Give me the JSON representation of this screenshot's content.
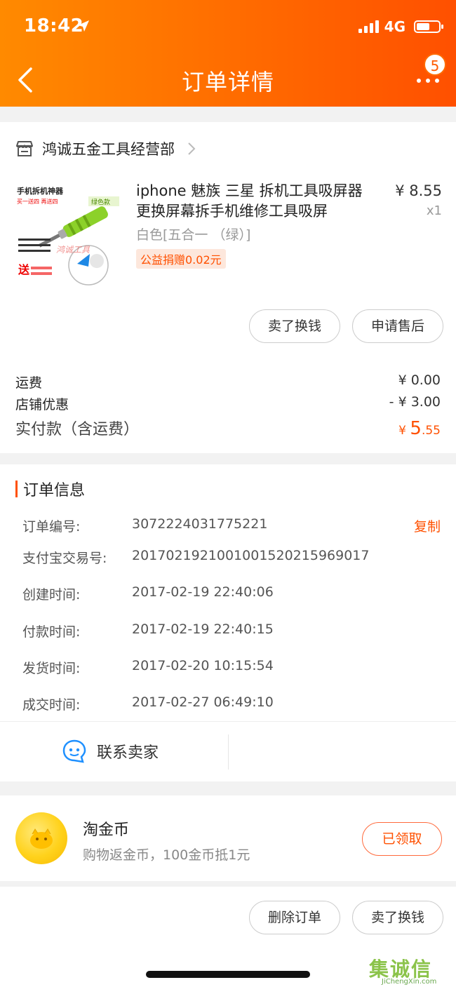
{
  "status_bar": {
    "time": "18:42",
    "network": "4G"
  },
  "nav": {
    "title": "订单详情",
    "more_badge": "5"
  },
  "shop": {
    "name": "鸿诚五金工具经营部"
  },
  "product": {
    "title_line1": "iphone 魅族 三星 拆机工具吸屏器",
    "title_line2": "更换屏幕拆手机维修工具吸屏",
    "price": "¥ 8.55",
    "quantity": "x1",
    "sku": "白色[五合一 （绿）]",
    "charity": "公益捐赠0.02元",
    "image_text": {
      "top_left": "手机拆机神器",
      "sub": "买一送四 再送四",
      "badge": "绿色款",
      "bottom": "送"
    },
    "actions": [
      "卖了换钱",
      "申请售后"
    ]
  },
  "fees": [
    {
      "label": "运费",
      "value": "¥ 0.00"
    },
    {
      "label": "店铺优惠",
      "value": "- ¥ 3.00"
    }
  ],
  "total": {
    "label": "实付款（含运费）",
    "currency": "¥ ",
    "int": "5",
    "dec": ".55"
  },
  "order_info": {
    "title": "订单信息",
    "copy_label": "复制",
    "rows": [
      {
        "label": "订单编号:",
        "value": "3072224031775221"
      },
      {
        "label": "支付宝交易号:",
        "value": "2017021921001001520215969017"
      },
      {
        "label": "创建时间:",
        "value": "2017-02-19 22:40:06"
      },
      {
        "label": "付款时间:",
        "value": "2017-02-19 22:40:15"
      },
      {
        "label": "发货时间:",
        "value": "2017-02-20 10:15:54"
      },
      {
        "label": "成交时间:",
        "value": "2017-02-27 06:49:10"
      }
    ]
  },
  "contact": {
    "label": "联系卖家"
  },
  "coin": {
    "title": "淘金币",
    "subtitle": "购物返金币，100金币抵1元",
    "button": "已领取"
  },
  "bottom_actions": [
    "删除订单",
    "卖了换钱"
  ],
  "watermark": {
    "cjk": "集诚信",
    "latin": "JiChengXin.com"
  },
  "colors": {
    "accent": "#ff5000",
    "header_start": "#ff8a00",
    "header_end": "#ff5000"
  }
}
